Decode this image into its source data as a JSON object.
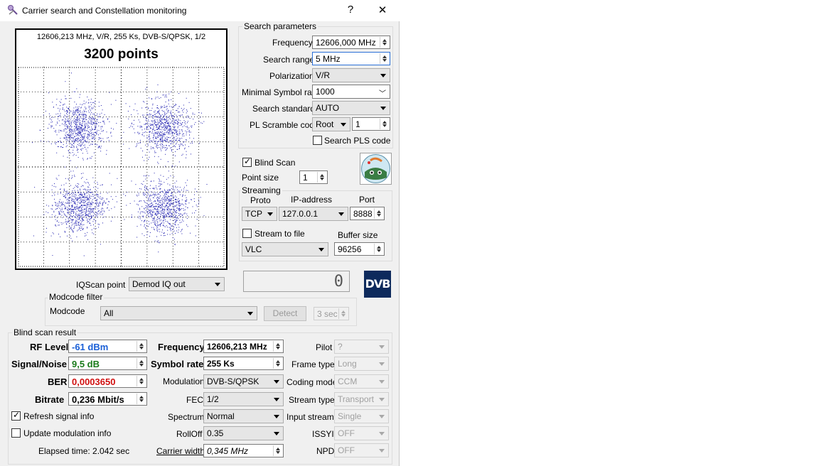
{
  "window": {
    "title": "Carrier search and Constellation monitoring",
    "help_glyph": "?",
    "close_glyph": "✕",
    "icon": "satellite-app-icon"
  },
  "plot": {
    "info": "12606,213 MHz, V/R, 255 Ks, DVB-S/QPSK, 1/2",
    "points_label": "3200 points",
    "point_color": "#1f1fb0",
    "clusters": [
      {
        "i": -1,
        "q": 1,
        "count": 800
      },
      {
        "i": 1,
        "q": 1,
        "count": 800
      },
      {
        "i": -1,
        "q": -1,
        "count": 800
      },
      {
        "i": 1,
        "q": -1,
        "count": 800
      }
    ]
  },
  "search_params": {
    "title": "Search parameters",
    "frequency_label": "Frequency",
    "frequency_value": "12606,000 MHz",
    "search_range_label": "Search range",
    "search_range_value": "5 MHz",
    "polarization_label": "Polarization",
    "polarization_value": "V/R",
    "min_symbol_rate_label": "Minimal Symbol rate",
    "min_symbol_rate_value": "1000",
    "search_standard_label": "Search standard",
    "search_standard_value": "AUTO",
    "pl_scramble_label": "PL Scramble code",
    "pl_scramble_mode": "Root",
    "pl_scramble_value": "1",
    "search_pls_label": "Search PLS code"
  },
  "blind_scan": {
    "label": "Blind Scan",
    "checked": true,
    "point_size_label": "Point size",
    "point_size_value": "1"
  },
  "streaming": {
    "title": "Streaming",
    "proto_label": "Proto",
    "proto_value": "TCP",
    "ip_label": "IP-address",
    "ip_value": "127.0.0.1",
    "port_label": "Port",
    "port_value": "8888",
    "stream_to_file_label": "Stream to file",
    "buffer_size_label": "Buffer size",
    "player_value": "VLC",
    "buffer_size_value": "96256"
  },
  "iqscan": {
    "label": "IQScan point",
    "value": "Demod IQ out",
    "lcd_value": "0"
  },
  "dvb_logo": "DVB",
  "modcode_filter": {
    "title": "Modcode filter",
    "modcode_label": "Modcode",
    "modcode_value": "All",
    "detect_label": "Detect",
    "timeout_value": "3 sec"
  },
  "result": {
    "title": "Blind scan result",
    "rf_level_label": "RF Level",
    "rf_level_value": "-61 dBm",
    "snr_label": "Signal/Noise",
    "snr_value": "9,5 dB",
    "ber_label": "BER",
    "ber_value": "0,0003650",
    "bitrate_label": "Bitrate",
    "bitrate_value": "0,236 Mbit/s",
    "refresh_label": "Refresh signal info",
    "update_mod_label": "Update modulation info",
    "elapsed": "Elapsed time: 2.042 sec",
    "frequency_label": "Frequency",
    "frequency_value": "12606,213 MHz",
    "symbol_rate_label": "Symbol rate",
    "symbol_rate_value": "255 Ks",
    "modulation_label": "Modulation",
    "modulation_value": "DVB-S/QPSK",
    "fec_label": "FEC",
    "fec_value": "1/2",
    "spectrum_label": "Spectrum",
    "spectrum_value": "Normal",
    "rolloff_label": "RollOff",
    "rolloff_value": "0.35",
    "carrier_width_label": "Carrier width",
    "carrier_width_value": "0,345 MHz",
    "pilot_label": "Pilot",
    "pilot_value": "?",
    "frame_type_label": "Frame type",
    "frame_type_value": "Long",
    "coding_mode_label": "Coding mode",
    "coding_mode_value": "CCM",
    "stream_type_label": "Stream type",
    "stream_type_value": "Transport",
    "input_stream_label": "Input stream",
    "input_stream_value": "Single",
    "issyi_label": "ISSYI",
    "issyi_value": "OFF",
    "npd_label": "NPD",
    "npd_value": "OFF",
    "colors": {
      "rf": "#1a5fd6",
      "snr": "#1a7a1a",
      "ber": "#d01010"
    }
  }
}
